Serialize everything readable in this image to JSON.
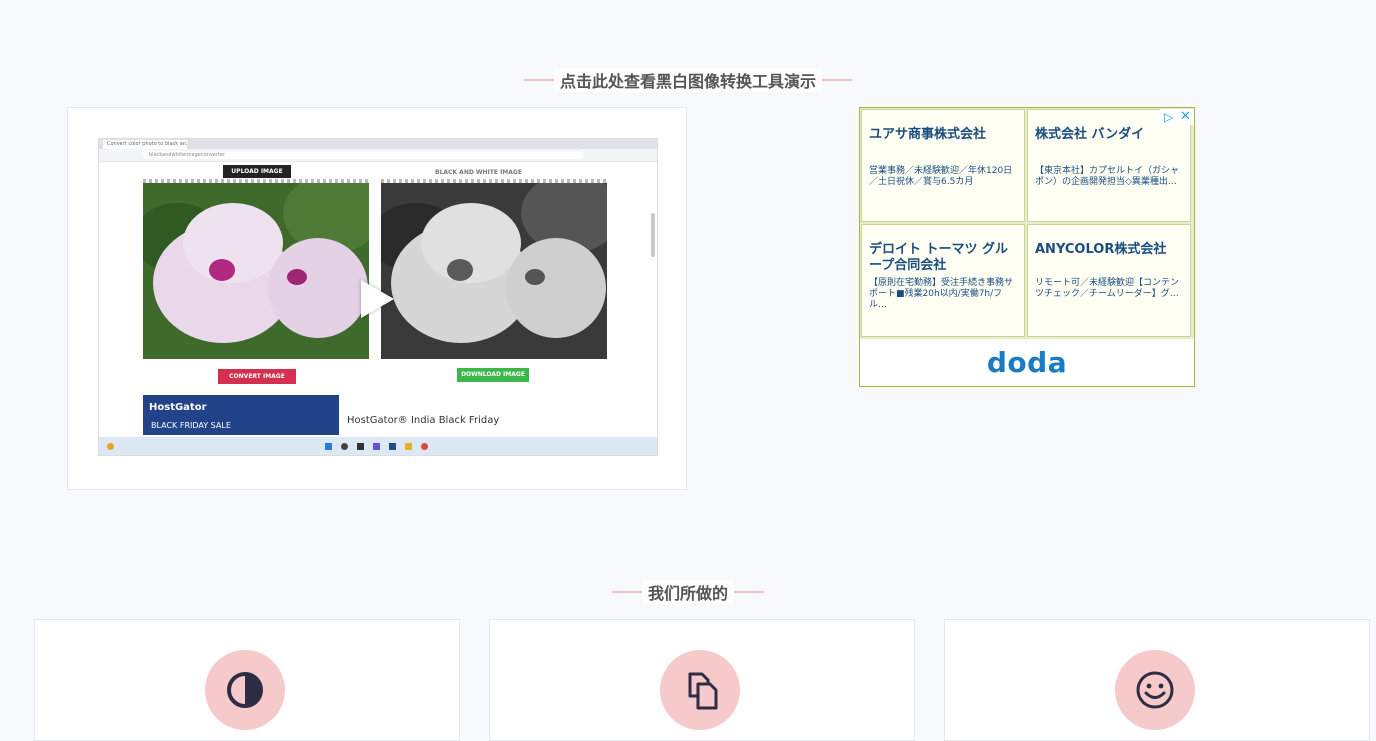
{
  "demo_section": {
    "heading": "点击此处查看黑白图像转换工具演示",
    "video": {
      "browser_tab": "Convert color photo to black an...",
      "url": "blackandwhiteimageconverter",
      "upload_label": "UPLOAD IMAGE",
      "bw_label": "BLACK AND WHITE IMAGE",
      "convert_label": "CONVERT IMAGE",
      "download_label": "DOWNLOAD IMAGE",
      "ad_brand": "HostGator",
      "ad_sale": "BLACK FRIDAY SALE",
      "ad_title": "HostGator® India Black Friday",
      "play_icon": "play-icon"
    }
  },
  "ad": {
    "choice_icon": "adchoices-icon",
    "close_icon": "close-icon",
    "cells": [
      {
        "company": "ユアサ商事株式会社",
        "desc": "営業事務／未経験歓迎／年休120日／土日祝休／賞与6.5カ月"
      },
      {
        "company": "株式会社 バンダイ",
        "desc": "【東京本社】カプセルトイ（ガシャポン）の企画開発担当◇異業種出…"
      },
      {
        "company": "デロイト トーマツ グループ合同会社",
        "desc": "【原則在宅勤務】受注手続き事務サポート■残業20h以内/実働7h/フル…"
      },
      {
        "company": "ANYCOLOR株式会社",
        "desc": "リモート可／未経験歓迎【コンテンツチェック／チームリーダー】グ…"
      }
    ],
    "brand": "doda"
  },
  "services_section": {
    "heading": "我们所做的",
    "features": [
      {
        "icon": "contrast-icon"
      },
      {
        "icon": "copy-files-icon"
      },
      {
        "icon": "smiley-icon"
      }
    ]
  },
  "colors": {
    "accent_pink": "#f6c9cb",
    "ad_border": "#9dbb3b",
    "ad_text": "#1a4d7f",
    "doda_blue": "#1a7bc4"
  }
}
